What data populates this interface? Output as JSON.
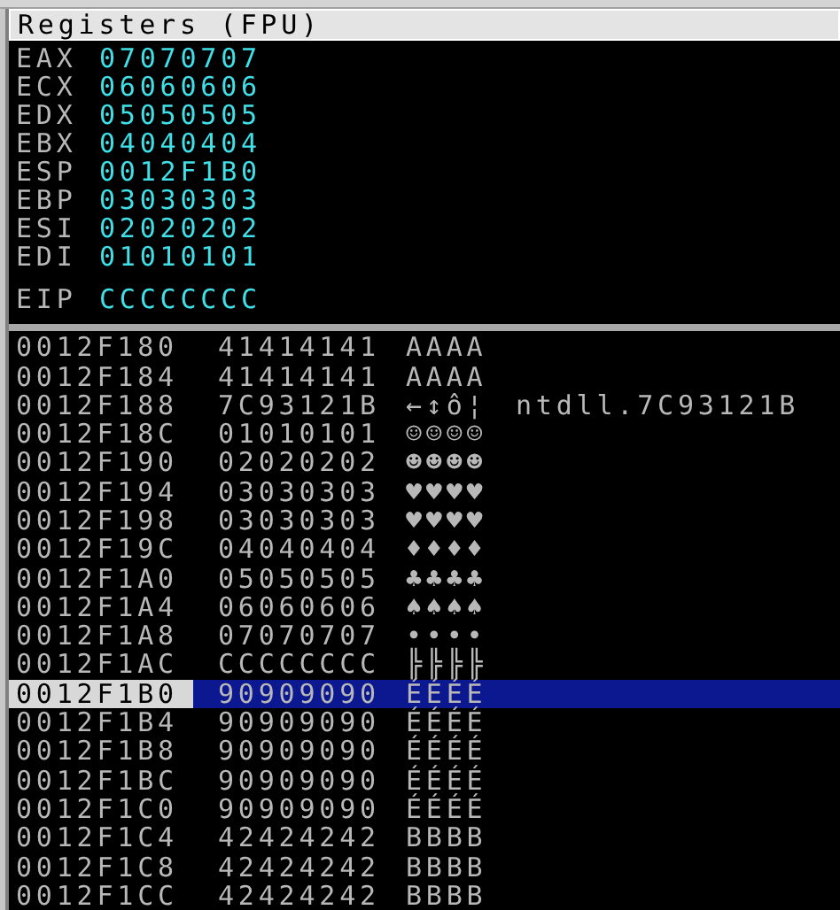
{
  "panel": {
    "title": "Registers (FPU)"
  },
  "registers": [
    {
      "name": "EAX",
      "value": "07070707"
    },
    {
      "name": "ECX",
      "value": "06060606"
    },
    {
      "name": "EDX",
      "value": "05050505"
    },
    {
      "name": "EBX",
      "value": "04040404"
    },
    {
      "name": "ESP",
      "value": "0012F1B0"
    },
    {
      "name": "EBP",
      "value": "03030303"
    },
    {
      "name": "ESI",
      "value": "02020202"
    },
    {
      "name": "EDI",
      "value": "01010101"
    }
  ],
  "eip": {
    "name": "EIP",
    "value": "CCCCCCCC"
  },
  "stack": [
    {
      "address": "0012F180",
      "value": "41414141",
      "ascii": "AAAA",
      "selected": false
    },
    {
      "address": "0012F184",
      "value": "41414141",
      "ascii": "AAAA",
      "selected": false
    },
    {
      "address": "0012F188",
      "value": "7C93121B",
      "ascii": "←↕ô¦",
      "comment": "ntdll.7C93121B",
      "selected": false
    },
    {
      "address": "0012F18C",
      "value": "01010101",
      "ascii": "☺☺☺☺",
      "selected": false
    },
    {
      "address": "0012F190",
      "value": "02020202",
      "ascii": "☻☻☻☻",
      "selected": false
    },
    {
      "address": "0012F194",
      "value": "03030303",
      "ascii": "♥♥♥♥",
      "selected": false
    },
    {
      "address": "0012F198",
      "value": "03030303",
      "ascii": "♥♥♥♥",
      "selected": false
    },
    {
      "address": "0012F19C",
      "value": "04040404",
      "ascii": "♦♦♦♦",
      "selected": false
    },
    {
      "address": "0012F1A0",
      "value": "05050505",
      "ascii": "♣♣♣♣",
      "selected": false
    },
    {
      "address": "0012F1A4",
      "value": "06060606",
      "ascii": "♠♠♠♠",
      "selected": false
    },
    {
      "address": "0012F1A8",
      "value": "07070707",
      "ascii": "••••",
      "selected": false
    },
    {
      "address": "0012F1AC",
      "value": "CCCCCCCC",
      "ascii": "╠╠╠╠",
      "selected": false
    },
    {
      "address": "0012F1B0",
      "value": "90909090",
      "ascii": "ÉÉÉÉ",
      "selected": true
    },
    {
      "address": "0012F1B4",
      "value": "90909090",
      "ascii": "ÉÉÉÉ",
      "selected": false
    },
    {
      "address": "0012F1B8",
      "value": "90909090",
      "ascii": "ÉÉÉÉ",
      "selected": false
    },
    {
      "address": "0012F1BC",
      "value": "90909090",
      "ascii": "ÉÉÉÉ",
      "selected": false
    },
    {
      "address": "0012F1C0",
      "value": "90909090",
      "ascii": "ÉÉÉÉ",
      "selected": false
    },
    {
      "address": "0012F1C4",
      "value": "42424242",
      "ascii": "BBBB",
      "selected": false
    },
    {
      "address": "0012F1C8",
      "value": "42424242",
      "ascii": "BBBB",
      "selected": false
    },
    {
      "address": "0012F1CC",
      "value": "42424242",
      "ascii": "BBBB",
      "selected": false
    }
  ]
}
